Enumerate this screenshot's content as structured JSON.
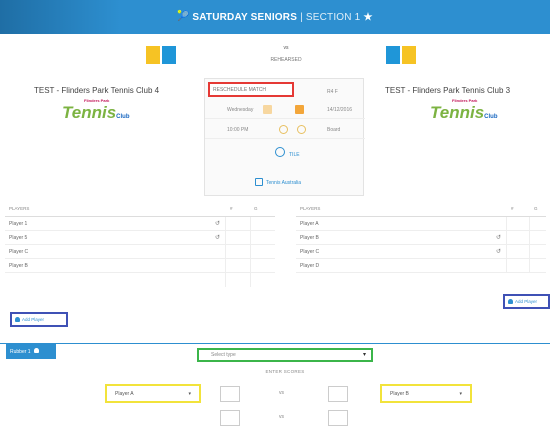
{
  "header": {
    "title": "SATURDAY SENIORS",
    "subtitle": "| SECTION 1"
  },
  "match": {
    "vs": "vs",
    "status": "REHEARSED"
  },
  "home_team": {
    "name": "TEST - Flinders Park Tennis Club 4",
    "logo_top": "Flinders Park",
    "logo_main": "Tennis",
    "logo_club": "Club"
  },
  "away_team": {
    "name": "TEST - Flinders Park Tennis Club 3",
    "logo_top": "Flinders Park",
    "logo_main": "Tennis",
    "logo_club": "Club"
  },
  "details": {
    "round_value": "RESCHEDULE MATCH",
    "round_label": "R4 F",
    "day": "Wednesday",
    "date": "14/12/2016",
    "time": "10:00 PM",
    "court": "Board",
    "venue_link": "TILE",
    "tennis_link": "Tennis Australia"
  },
  "home_players": {
    "header_players": "PLAYERS",
    "header_c1": "#",
    "header_c2": "G",
    "rows": [
      "Player 1",
      "Player 5",
      "Player C",
      "Player B"
    ]
  },
  "away_players": {
    "header_players": "PLAYERS",
    "header_c1": "#",
    "header_c2": "G",
    "rows": [
      "Player A",
      "Player B",
      "Player C",
      "Player D"
    ]
  },
  "add_player_label": "Add Player",
  "match_tab": {
    "label": "Rubber 1"
  },
  "rubber_select": {
    "placeholder": "Select type"
  },
  "scores_label": "ENTER SCORES",
  "player_select_home": {
    "value": "Player A"
  },
  "player_select_away": {
    "value": "Player B"
  },
  "score_vs": "vs",
  "colors": {
    "brand": "#2d8fd0",
    "highlight_red": "#e53935",
    "highlight_blue": "#3f51b5",
    "highlight_green": "#3bb54a",
    "highlight_yellow": "#f2e33b",
    "flag_yellow": "#f6c324",
    "flag_blue": "#1f96d8"
  }
}
